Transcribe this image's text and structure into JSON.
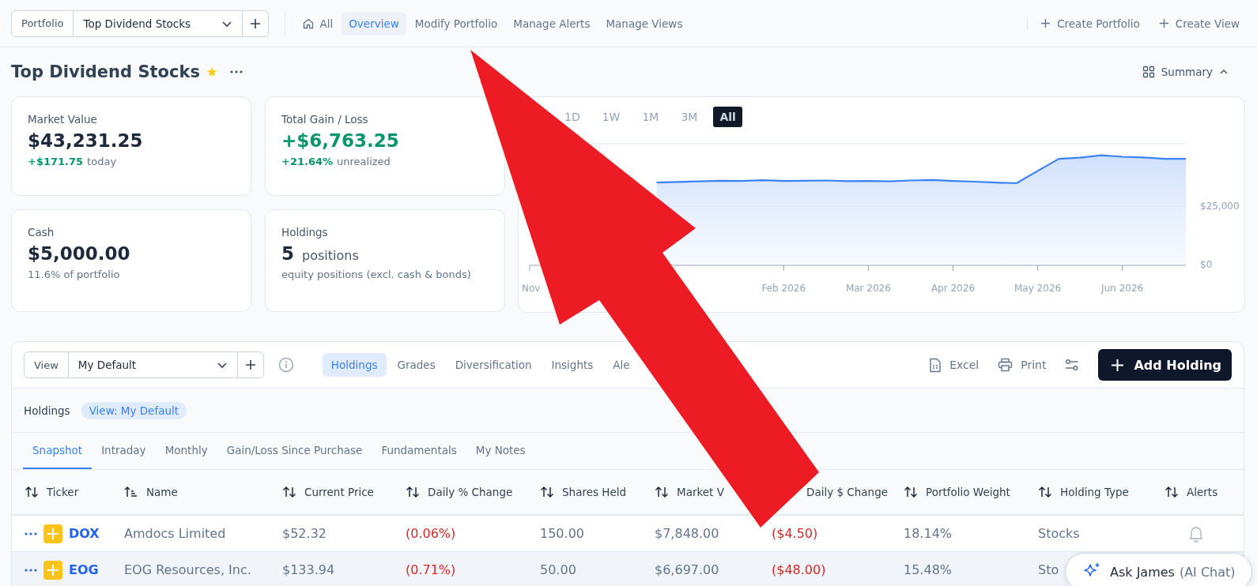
{
  "top_bar": {
    "portfolio_label": "Portfolio",
    "portfolio_select": "Top Dividend Stocks",
    "nav": [
      {
        "label": "All",
        "kind": "home",
        "selected": false
      },
      {
        "label": "Overview",
        "kind": "text",
        "selected": true
      },
      {
        "label": "Modify Portfolio",
        "kind": "text",
        "selected": false
      },
      {
        "label": "Manage Alerts",
        "kind": "text",
        "selected": false
      },
      {
        "label": "Manage Views",
        "kind": "text",
        "selected": false
      }
    ],
    "actions": [
      "Create Portfolio",
      "Create View"
    ]
  },
  "header": {
    "title": "Top Dividend Stocks",
    "favorite": true,
    "summary_toggle": "Summary",
    "expanded": true
  },
  "stats": [
    {
      "kind": "money",
      "label": "Market Value",
      "value": "$43,231.25",
      "change": "+$171.75",
      "note": "today",
      "positive": true
    },
    {
      "kind": "money",
      "label": "Total Gain / Loss",
      "value": "+$6,763.25",
      "change": "+21.64%",
      "note": "unrealized",
      "positive": true
    },
    {
      "kind": "plain",
      "label": "Cash",
      "value": "$5,000.00",
      "note": "11.6% of portfolio"
    },
    {
      "kind": "count",
      "label": "Holdings",
      "value": "5",
      "unit": "positions",
      "note": "equity positions (excl. cash & bonds)"
    }
  ],
  "chart": {
    "ranges": [
      {
        "label": "1D",
        "selected": false
      },
      {
        "label": "1W",
        "selected": false
      },
      {
        "label": "1M",
        "selected": false
      },
      {
        "label": "3M",
        "selected": false
      },
      {
        "label": "All",
        "selected": true
      }
    ],
    "chart_data": {
      "type": "area",
      "categories": [
        "Nov",
        null,
        null,
        null,
        null,
        null,
        null,
        null,
        null,
        null,
        null,
        null,
        "Feb 2026",
        null,
        null,
        null,
        "Mar 2026",
        null,
        null,
        null,
        "Apr 2026",
        null,
        null,
        null,
        "May 2026",
        null,
        null,
        null,
        "Jun 2026",
        null,
        null,
        null
      ],
      "series": [
        {
          "color": "#3b82f6",
          "values": [
            null,
            null,
            null,
            null,
            null,
            null,
            35300,
            35600,
            35800,
            36100,
            36000,
            36300,
            36000,
            36100,
            36200,
            35900,
            36000,
            35800,
            36200,
            36400,
            36000,
            35700,
            35300,
            35000,
            40300,
            45500,
            46000,
            47000,
            46400,
            46100,
            45500,
            45500
          ]
        }
      ],
      "ylim": [
        0,
        52000
      ],
      "yticks": [
        {
          "value": 0,
          "label": "$0"
        },
        {
          "value": 25000,
          "label": "$25,000"
        }
      ]
    }
  },
  "holdings_panel": {
    "view_label": "View",
    "view_select": "My Default",
    "tabs": [
      {
        "label": "Holdings",
        "selected": true
      },
      {
        "label": "Grades",
        "selected": false
      },
      {
        "label": "Diversification",
        "selected": false
      },
      {
        "label": "Insights",
        "selected": false
      },
      {
        "label": "Ale",
        "selected": false
      }
    ],
    "tools": [
      {
        "kind": "excel",
        "label": "Excel"
      },
      {
        "kind": "print",
        "label": "Print"
      },
      {
        "kind": "settings"
      }
    ],
    "add_button": "Add Holding",
    "breadcrumb": "Holdings",
    "view_chip": "View: My Default",
    "subtabs": [
      {
        "label": "Snapshot",
        "selected": true
      },
      {
        "label": "Intraday",
        "selected": false
      },
      {
        "label": "Monthly",
        "selected": false
      },
      {
        "label": "Gain/Loss Since Purchase",
        "selected": false
      },
      {
        "label": "Fundamentals",
        "selected": false
      },
      {
        "label": "My Notes",
        "selected": false
      }
    ],
    "table": {
      "columns": [
        {
          "label": "Ticker",
          "kind": "sortable"
        },
        {
          "label": "Name",
          "kind": "sorted"
        },
        {
          "label": "Current Price",
          "kind": "sortable"
        },
        {
          "label": "Daily % Change",
          "kind": "sortable"
        },
        {
          "label": "Shares Held",
          "kind": "sortable"
        },
        {
          "label": "Market V",
          "kind": "sortable"
        },
        {
          "label": "Daily $ Change",
          "kind": "plain"
        },
        {
          "label": "Portfolio Weight",
          "kind": "sortable"
        },
        {
          "label": "Holding Type",
          "kind": "sortable"
        },
        {
          "label": "Alerts",
          "kind": "sortable"
        }
      ],
      "rows": [
        {
          "ticker": "DOX",
          "name": "Amdocs Limited",
          "price": "$52.32",
          "daily_pct": "(0.06%)",
          "shares": "150.00",
          "market_value": "$7,848.00",
          "daily_usd": "($4.50)",
          "weight": "18.14%",
          "type": "Stocks",
          "negative": true,
          "alert_bell": true,
          "selected": false
        },
        {
          "ticker": "EOG",
          "name": "EOG Resources, Inc.",
          "price": "$133.94",
          "daily_pct": "(0.71%)",
          "shares": "50.00",
          "market_value": "$6,697.00",
          "daily_usd": "($48.00)",
          "weight": "15.48%",
          "type": "Sto",
          "negative": true,
          "selected": true
        }
      ]
    }
  },
  "chat_button": {
    "label": "Ask James",
    "note": "(AI Chat)"
  },
  "annotation": {
    "kind": "arrow"
  }
}
